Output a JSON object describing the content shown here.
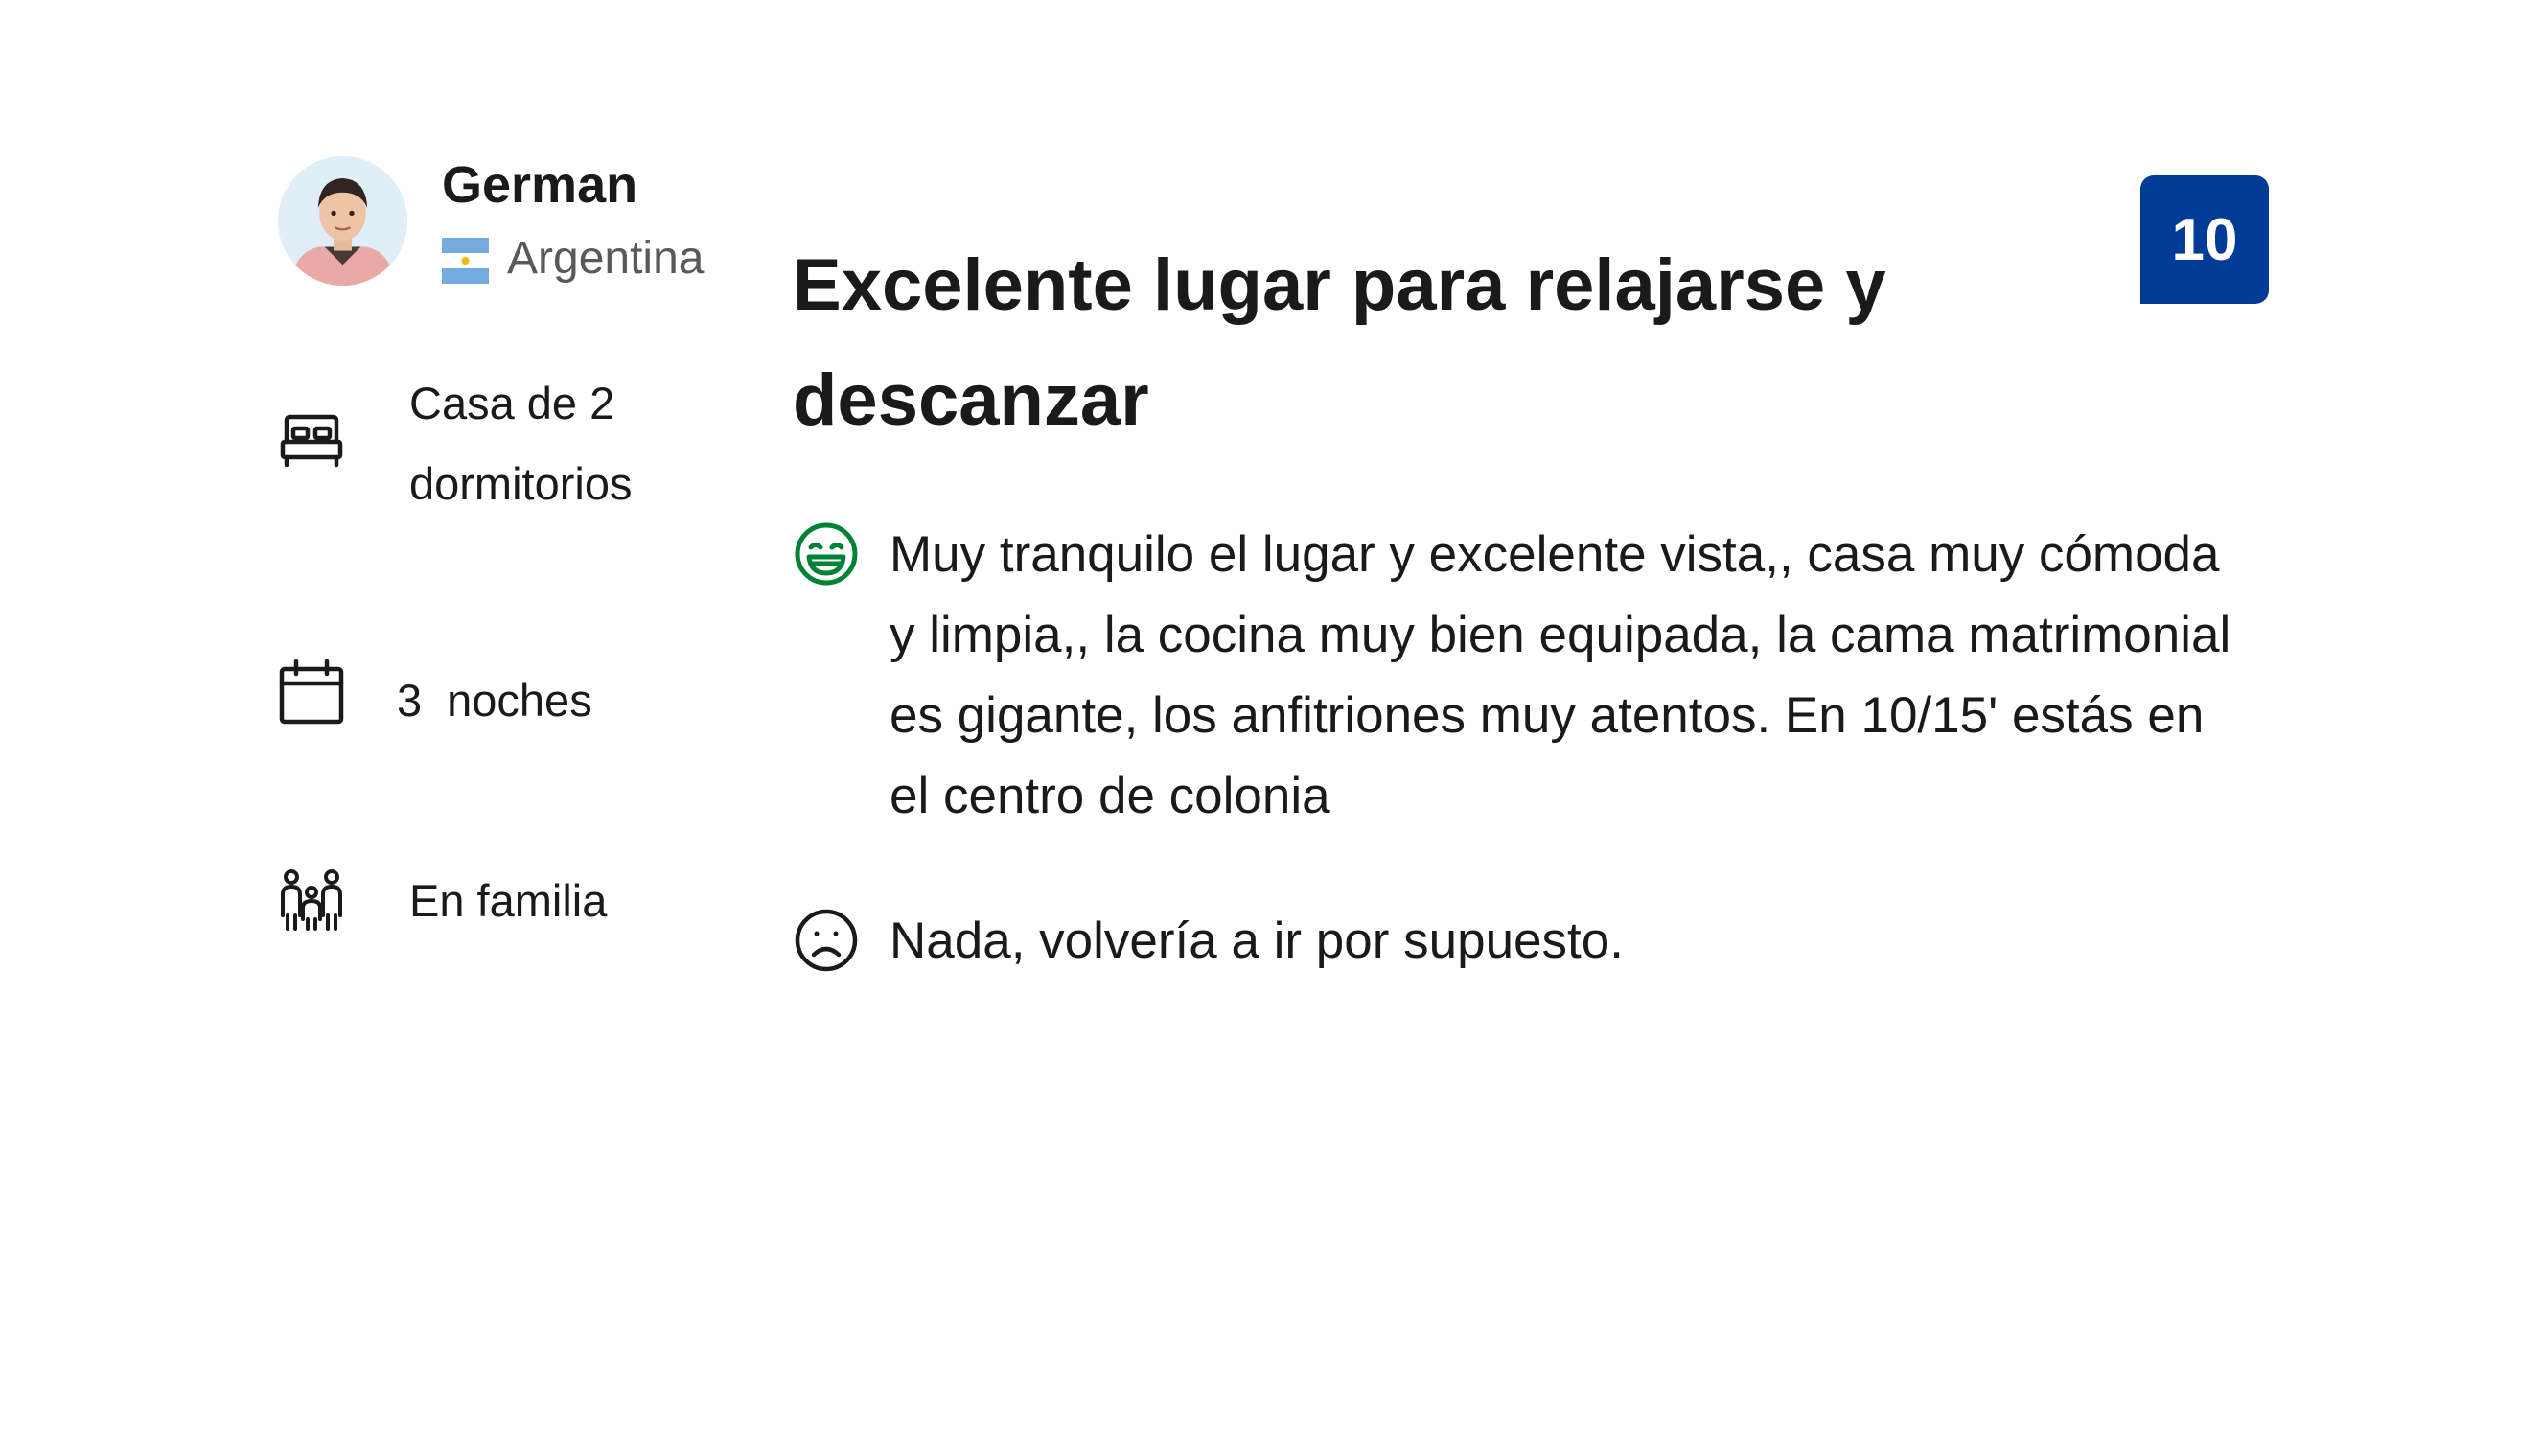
{
  "reviewer": {
    "name": "German",
    "country": "Argentina"
  },
  "stay": {
    "room": "Casa de 2 dormitorios",
    "nights_count": "3",
    "nights_label": "noches",
    "traveler_type": "En familia"
  },
  "review": {
    "title": "Excelente lugar para relajarse y descanzar",
    "score": "10",
    "positive": "Muy tranquilo el lugar y excelente vista,, casa muy cómoda y limpia,, la cocina muy bien equipada, la cama matrimonial es gigante, los anfitriones muy atentos. En 10/15' estás en el centro de colonia",
    "negative": "Nada, volvería a ir por supuesto."
  },
  "icons": {
    "avatar": "avatar",
    "flag": "argentina-flag-icon",
    "room": "bed-icon",
    "nights": "calendar-icon",
    "traveler": "group-icon",
    "positive": "smile-icon",
    "negative": "frown-icon"
  },
  "colors": {
    "score_badge": "#003b95",
    "positive_icon": "#008234",
    "text": "#1a1a1a",
    "secondary_text": "#595959"
  }
}
